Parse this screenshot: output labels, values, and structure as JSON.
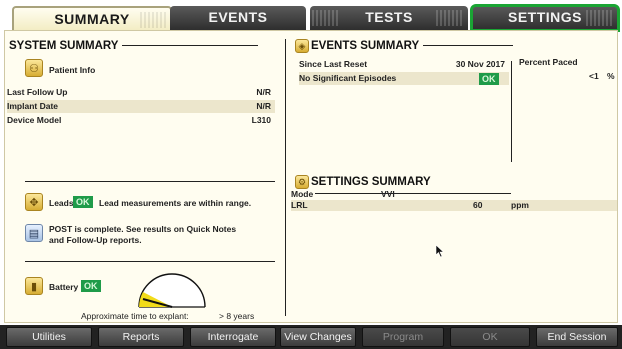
{
  "tabs": [
    {
      "label": "SUMMARY",
      "active": true
    },
    {
      "label": "EVENTS",
      "active": false
    },
    {
      "label": "TESTS",
      "active": false
    },
    {
      "label": "SETTINGS",
      "active": false,
      "highlighted": true
    }
  ],
  "system_summary": {
    "title": "SYSTEM SUMMARY",
    "patient_info_label": "Patient Info",
    "rows": [
      {
        "label": "Last Follow Up",
        "value": "N/R"
      },
      {
        "label": "Implant Date",
        "value": "N/R"
      },
      {
        "label": "Device Model",
        "value": "L310"
      }
    ],
    "leads_label": "Leads",
    "leads_status": "OK",
    "leads_message": "Lead measurements are within range.",
    "post_message_line1": "POST is complete. See results on Quick Notes",
    "post_message_line2": "and Follow-Up reports.",
    "battery_label": "Battery",
    "battery_status": "OK",
    "explant_label": "Approximate time to explant:",
    "explant_value": "> 8 years"
  },
  "events_summary": {
    "title": "EVENTS SUMMARY",
    "since_label": "Since Last Reset",
    "since_date": "30 Nov 2017",
    "episodes_label": "No Significant Episodes",
    "episodes_status": "OK",
    "percent_paced_label": "Percent Paced",
    "percent_paced_value": "<1",
    "percent_unit": "%"
  },
  "settings_summary": {
    "title": "SETTINGS SUMMARY",
    "mode_label": "Mode",
    "mode_value": "VVI",
    "lrl_label": "LRL",
    "lrl_value": "60",
    "lrl_unit": "ppm"
  },
  "buttons": [
    {
      "label": "Utilities",
      "enabled": true
    },
    {
      "label": "Reports",
      "enabled": true
    },
    {
      "label": "Interrogate",
      "enabled": true
    },
    {
      "label": "View Changes",
      "enabled": true
    },
    {
      "label": "Program",
      "enabled": false
    },
    {
      "label": "OK",
      "enabled": false
    },
    {
      "label": "End Session",
      "enabled": true
    }
  ],
  "colors": {
    "ok_green": "#1f9b49",
    "highlight_green": "#1aa534",
    "panel_bg": "#fffdf0",
    "battery_fill": "#f2dc1a"
  },
  "icons": [
    "patient-info-icon",
    "events-summary-icon",
    "settings-summary-icon",
    "leads-icon",
    "post-icon",
    "battery-icon",
    "mouse-cursor-icon"
  ]
}
